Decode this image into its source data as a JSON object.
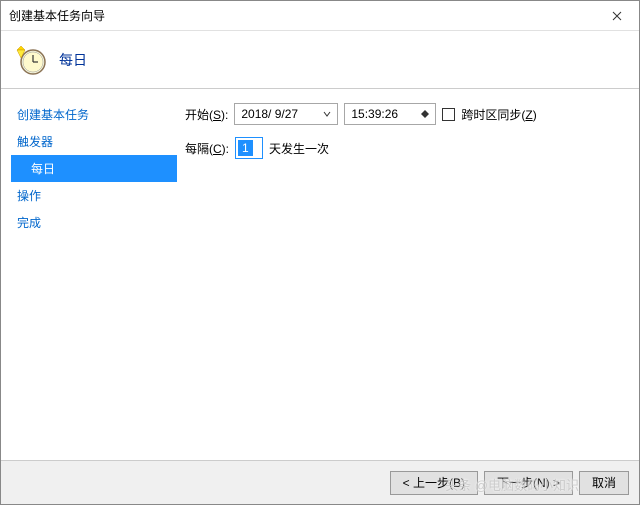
{
  "titlebar": {
    "title": "创建基本任务向导"
  },
  "header": {
    "title": "每日"
  },
  "sidebar": {
    "items": [
      {
        "label": "创建基本任务"
      },
      {
        "label": "触发器"
      },
      {
        "label": "每日"
      },
      {
        "label": "操作"
      },
      {
        "label": "完成"
      }
    ]
  },
  "content": {
    "start_label_pre": "开始(",
    "start_label_key": "S",
    "start_label_post": "):",
    "date": "2018/ 9/27",
    "time": "15:39:26",
    "sync_label_pre": "跨时区同步(",
    "sync_label_key": "Z",
    "sync_label_post": ")",
    "interval_label_pre": "每隔(",
    "interval_label_key": "C",
    "interval_label_post": "):",
    "interval_value": "1",
    "interval_suffix": "天发生一次"
  },
  "footer": {
    "back": "< 上一步(B)",
    "next": "下一步(N) >",
    "cancel": "取消"
  },
  "watermark": "头条 @电脑数码小知识"
}
